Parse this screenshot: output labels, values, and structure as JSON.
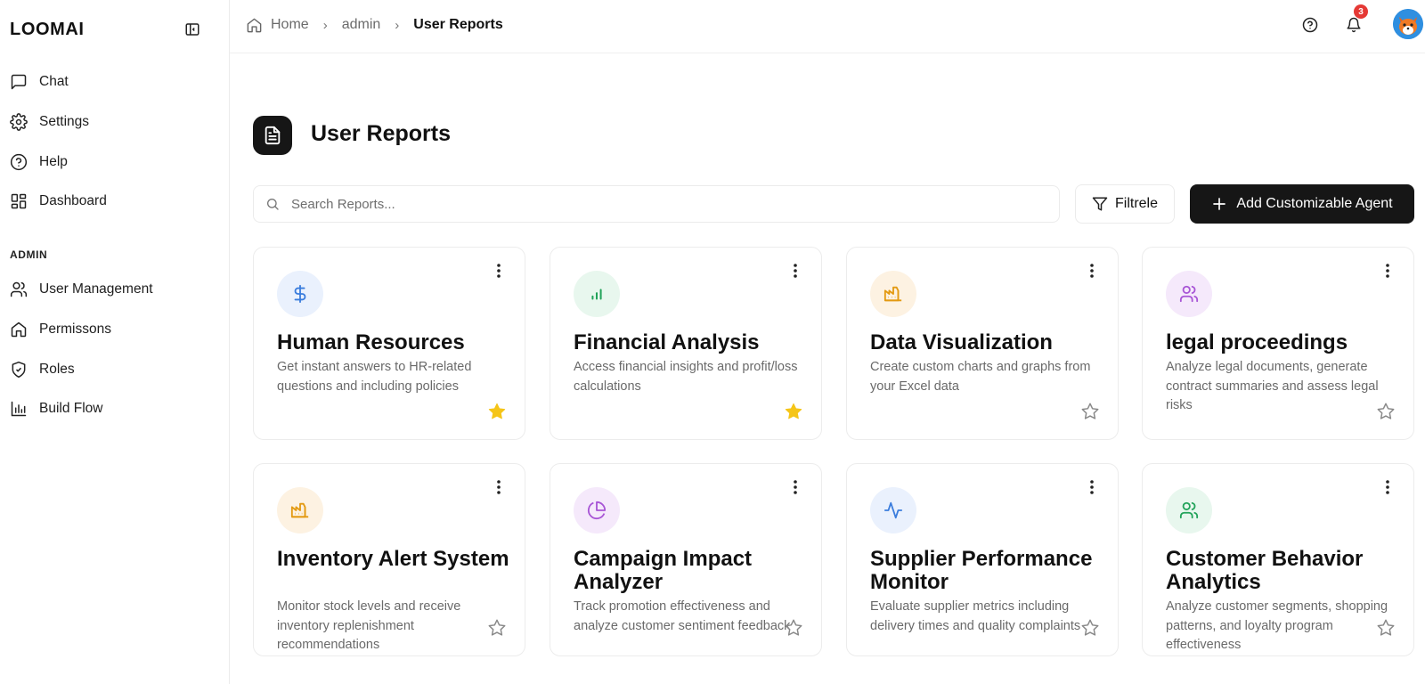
{
  "app": {
    "brand": "LOOMAI"
  },
  "sidebar": {
    "items": [
      {
        "label": "Chat",
        "icon": "message-square-icon"
      },
      {
        "label": "Settings",
        "icon": "gear-icon"
      },
      {
        "label": "Help",
        "icon": "help-circle-icon"
      },
      {
        "label": "Dashboard",
        "icon": "dashboard-icon"
      }
    ],
    "admin_label": "ADMIN",
    "admin_items": [
      {
        "label": "User Management",
        "icon": "users-icon"
      },
      {
        "label": "Permissons",
        "icon": "home-icon"
      },
      {
        "label": "Roles",
        "icon": "shield-check-icon"
      },
      {
        "label": "Build Flow",
        "icon": "bar-chart-icon"
      }
    ]
  },
  "header": {
    "breadcrumb": [
      "Home",
      "admin",
      "User Reports"
    ],
    "notifications_count": "3"
  },
  "page": {
    "title": "User Reports"
  },
  "toolbar": {
    "search_placeholder": "Search Reports...",
    "filter_label": "Filtrele",
    "add_label": "Add Customizable Agent"
  },
  "cards": [
    {
      "title": "Human Resources",
      "desc": "Get instant answers to HR-related questions and including policies",
      "icon": "dollar-icon",
      "icon_color": "#3b7ddd",
      "icon_bg": "#eaf1fd",
      "starred": true
    },
    {
      "title": "Financial Analysis",
      "desc": "Access financial insights and profit/loss calculations",
      "icon": "bar-chart-icon",
      "icon_color": "#22a35a",
      "icon_bg": "#e8f7ee",
      "starred": true
    },
    {
      "title": "Data Visualization",
      "desc": "Create custom charts and graphs from your Excel data",
      "icon": "factory-icon",
      "icon_color": "#e39a12",
      "icon_bg": "#fdf2e2",
      "starred": false
    },
    {
      "title": "legal proceedings",
      "desc": "Analyze legal documents, generate contract summaries and assess legal risks",
      "icon": "users-icon",
      "icon_color": "#a855d6",
      "icon_bg": "#f5e9fb",
      "starred": false
    },
    {
      "title": "Inventory Alert System",
      "desc": "Monitor stock levels and receive inventory replenishment recommendations",
      "icon": "factory-icon",
      "icon_color": "#e39a12",
      "icon_bg": "#fdf2e2",
      "starred": false
    },
    {
      "title": "Campaign Impact Analyzer",
      "desc": "Track promotion effectiveness and analyze customer sentiment feedback",
      "icon": "pie-chart-icon",
      "icon_color": "#a855d6",
      "icon_bg": "#f5e9fb",
      "starred": false
    },
    {
      "title": "Supplier Performance Monitor",
      "desc": "Evaluate supplier metrics including delivery times and quality complaints",
      "icon": "activity-icon",
      "icon_color": "#3b7ddd",
      "icon_bg": "#eaf1fd",
      "starred": false
    },
    {
      "title": "Customer Behavior Analytics",
      "desc": "Analyze customer segments, shopping patterns, and loyalty program effectiveness",
      "icon": "users-icon",
      "icon_color": "#22a35a",
      "icon_bg": "#e8f7ee",
      "starred": false
    }
  ],
  "colors": {
    "accent": "#161616",
    "star_filled": "#f5c518",
    "badge": "#e53935"
  }
}
